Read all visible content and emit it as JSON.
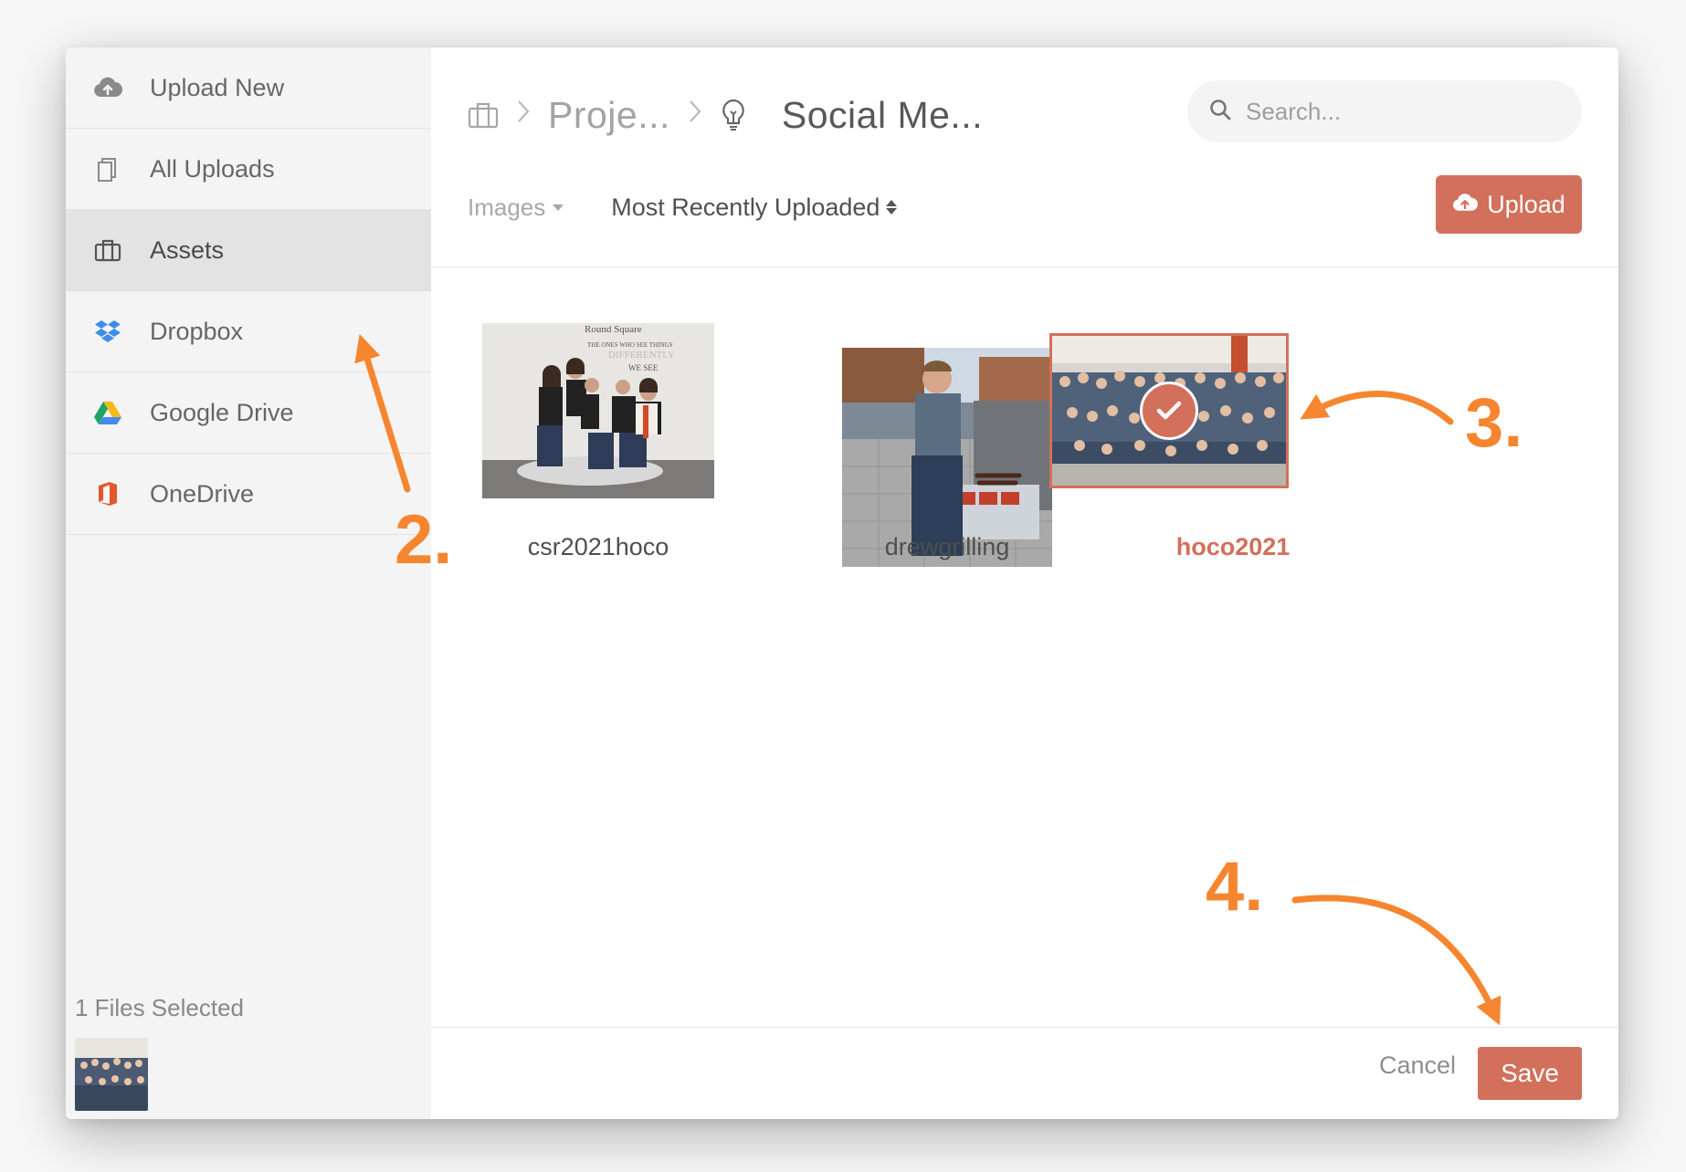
{
  "sidebar": {
    "items": [
      {
        "label": "Upload New",
        "icon": "cloud-upload-icon"
      },
      {
        "label": "All Uploads",
        "icon": "copy-icon"
      },
      {
        "label": "Assets",
        "icon": "briefcase-icon",
        "active": true
      },
      {
        "label": "Dropbox",
        "icon": "dropbox-icon"
      },
      {
        "label": "Google Drive",
        "icon": "google-drive-icon"
      },
      {
        "label": "OneDrive",
        "icon": "office-icon"
      }
    ],
    "selected_count_label": "1 Files Selected"
  },
  "breadcrumb": {
    "items": [
      "Proje...",
      "Social Me..."
    ]
  },
  "search": {
    "placeholder": "Search..."
  },
  "toolbar": {
    "filter_label": "Images",
    "sort_label": "Most Recently Uploaded",
    "upload_label": "Upload"
  },
  "files": [
    {
      "name": "csr2021hoco",
      "selected": false
    },
    {
      "name": "drewgrilling",
      "selected": false
    },
    {
      "name": "hoco2021",
      "selected": true
    }
  ],
  "footer": {
    "cancel_label": "Cancel",
    "save_label": "Save"
  },
  "annotations": [
    "2.",
    "3.",
    "4."
  ],
  "colors": {
    "accent": "#d2705b",
    "annotation": "#f5862f",
    "sidebar_bg": "#f4f4f4",
    "active_item_bg": "#e3e3e3"
  }
}
